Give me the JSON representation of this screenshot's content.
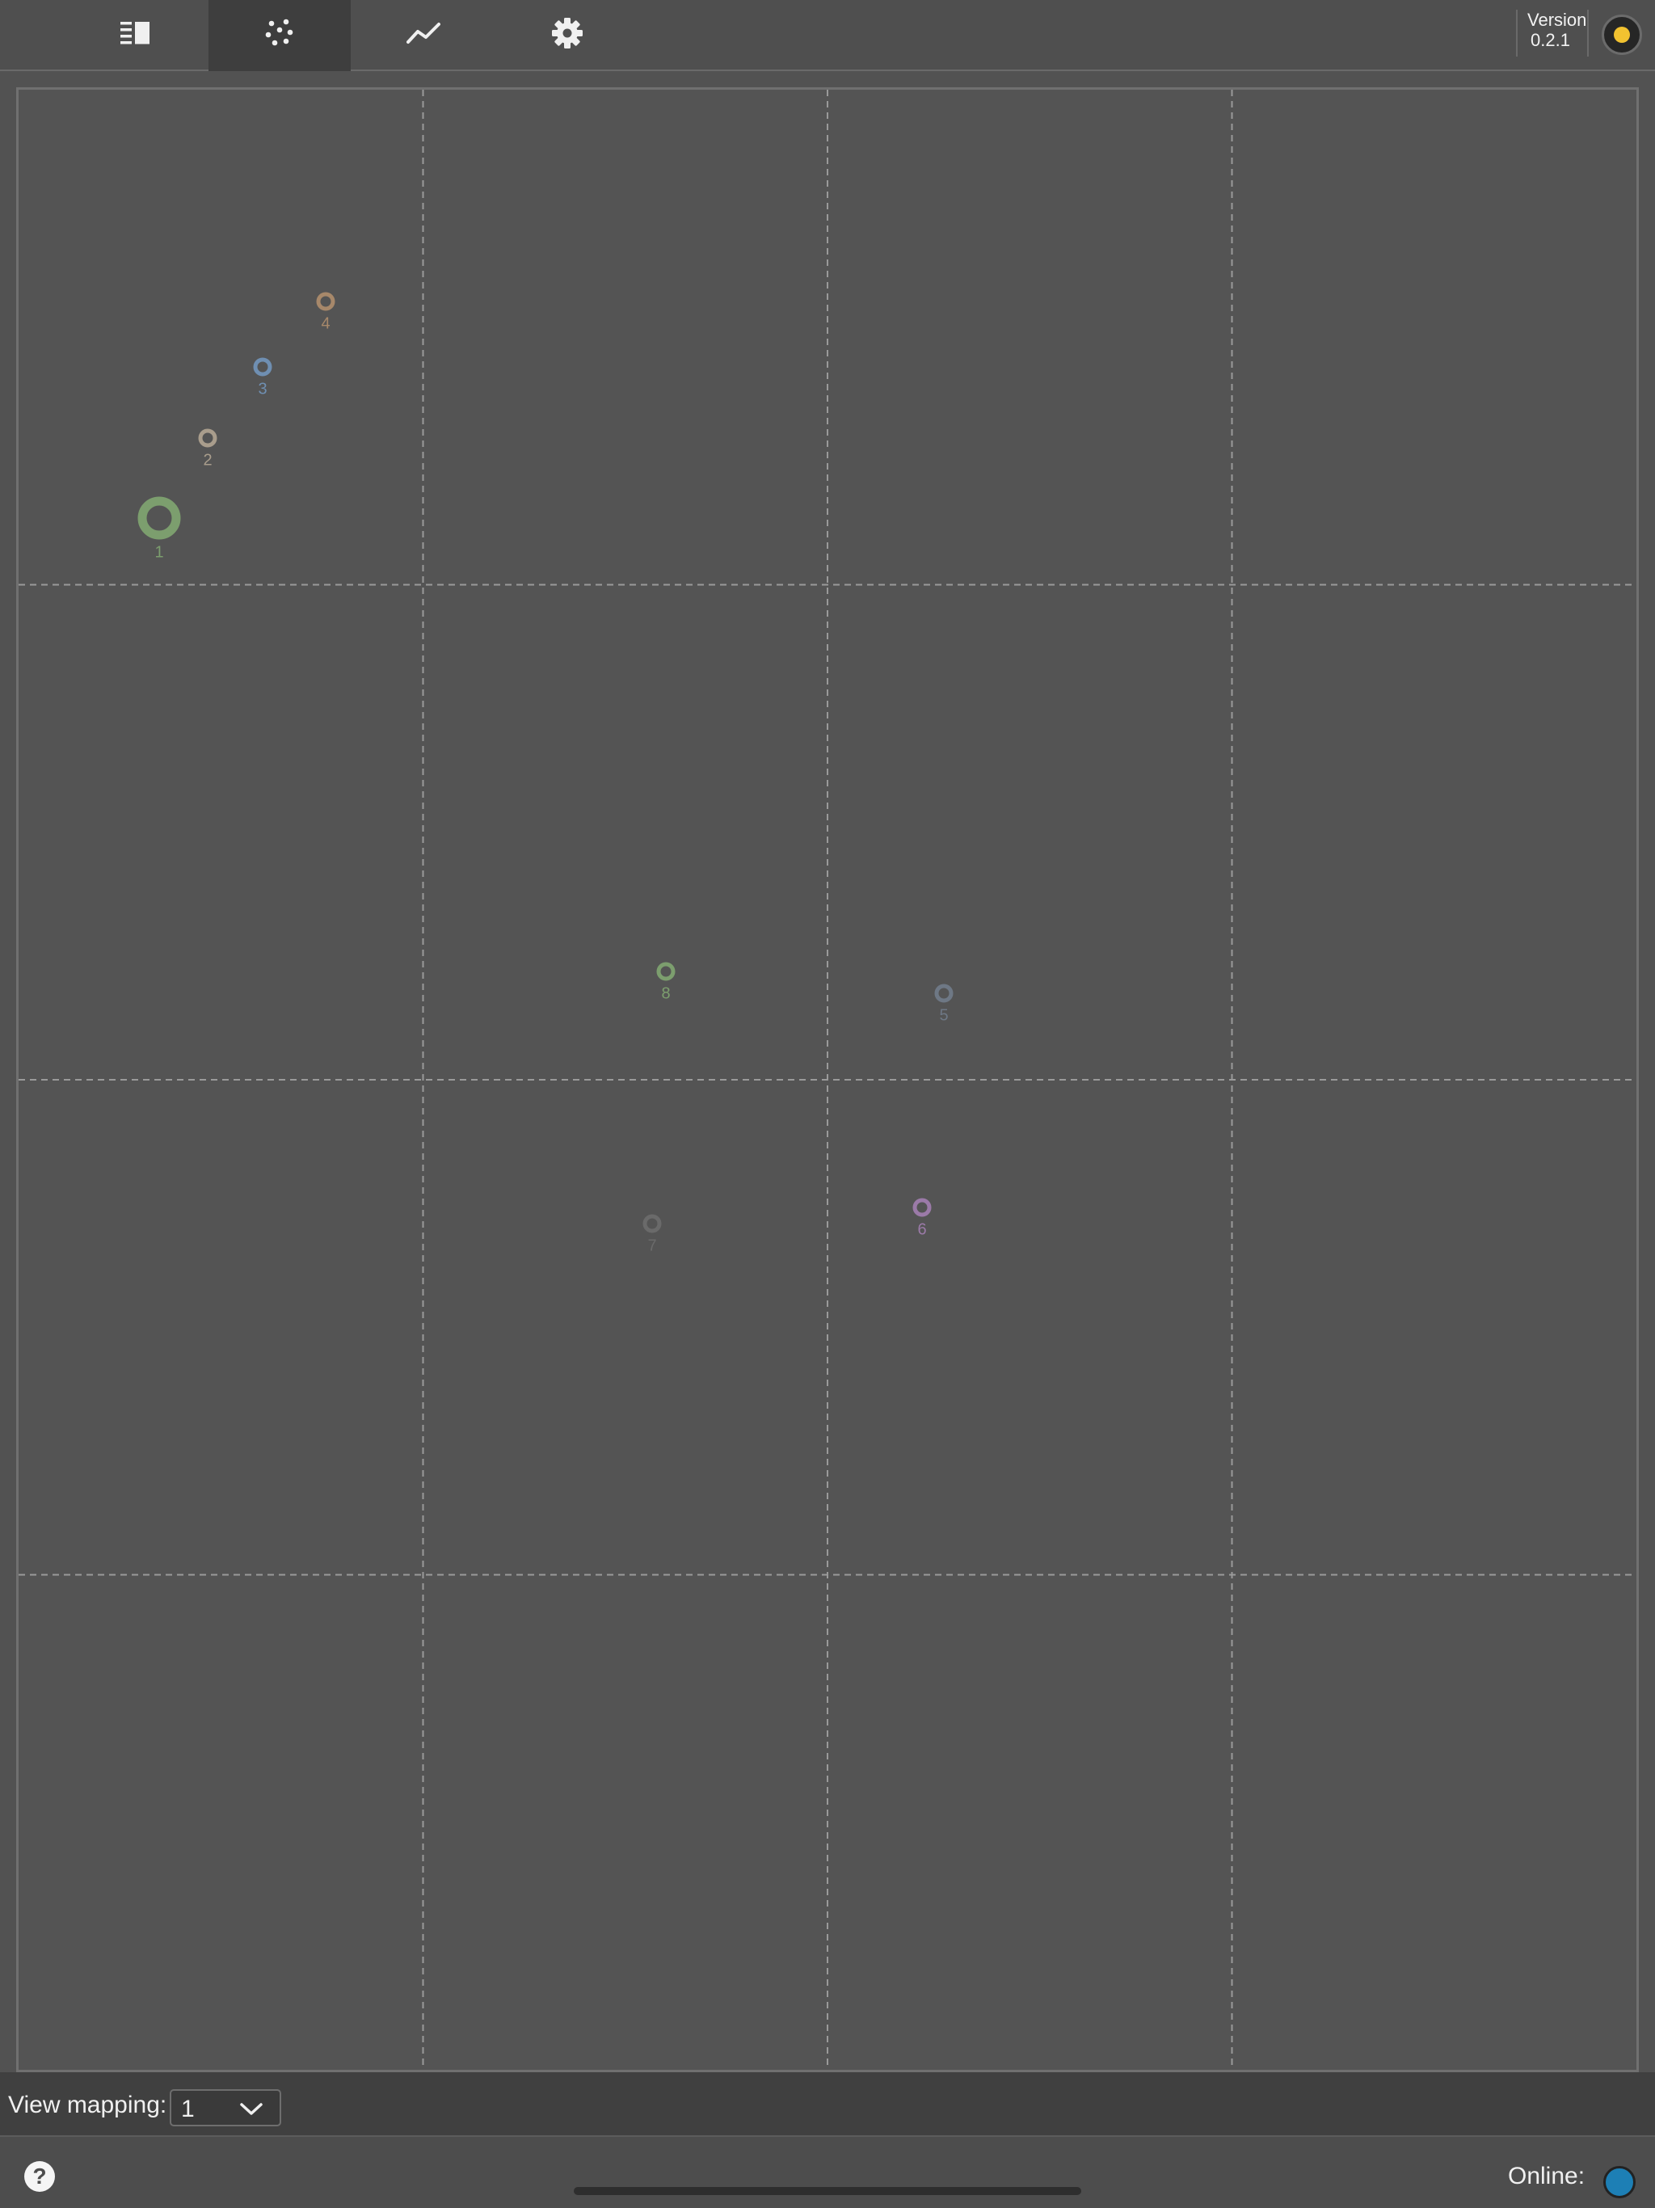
{
  "toolbar": {
    "tabs": [
      {
        "icon": "list-panel-icon",
        "active": false
      },
      {
        "icon": "scatter-dots-icon",
        "active": true
      },
      {
        "icon": "line-chart-icon",
        "active": false
      },
      {
        "icon": "gear-icon",
        "active": false
      }
    ],
    "version_label": "Version",
    "version_number": "0.2.1",
    "status_icon_color": "#f2c230"
  },
  "chart_data": {
    "type": "scatter",
    "grid": true,
    "points": [
      {
        "label": "1",
        "color": "#7c9e6e",
        "emphasized": true
      },
      {
        "label": "2",
        "color": "#a99d8c",
        "emphasized": false
      },
      {
        "label": "3",
        "color": "#6f8fb2",
        "emphasized": false
      },
      {
        "label": "4",
        "color": "#a7886a",
        "emphasized": false
      },
      {
        "label": "5",
        "color": "#6e7885",
        "emphasized": false
      },
      {
        "label": "6",
        "color": "#9b7aa8",
        "emphasized": false
      },
      {
        "label": "7",
        "color": "#6a6a6a",
        "emphasized": false
      },
      {
        "label": "8",
        "color": "#7c9e6e",
        "emphasized": false
      }
    ]
  },
  "footer": {
    "mapping_label": "View mapping:",
    "mapping_value": "1",
    "help_glyph": "?",
    "online_label": "Online:",
    "online_color": "#1d7fb5"
  }
}
